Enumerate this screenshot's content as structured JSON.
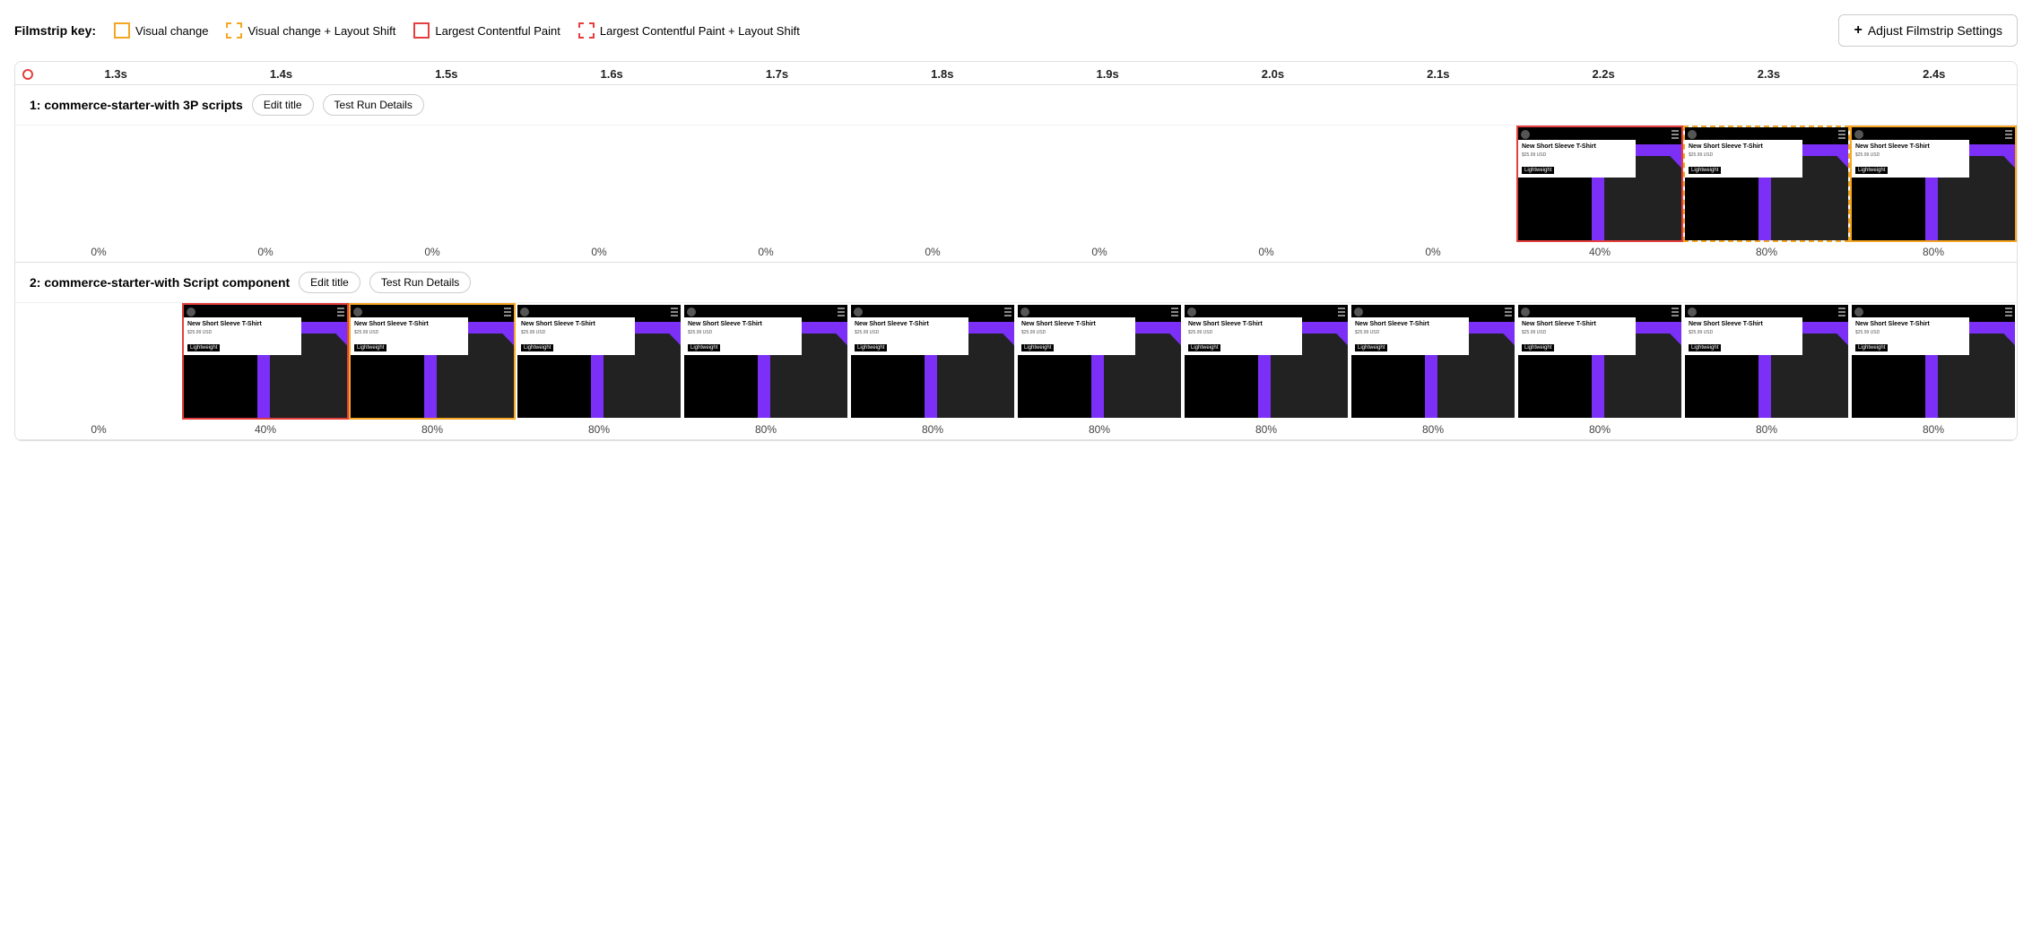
{
  "legend": {
    "key_label": "Filmstrip key:",
    "items": [
      {
        "id": "visual-change",
        "label": "Visual change",
        "border_style": "solid-yellow"
      },
      {
        "id": "visual-change-layout-shift",
        "label": "Visual change + Layout Shift",
        "border_style": "dashed-yellow"
      },
      {
        "id": "lcp",
        "label": "Largest Contentful Paint",
        "border_style": "solid-red"
      },
      {
        "id": "lcp-layout-shift",
        "label": "Largest Contentful Paint + Layout Shift",
        "border_style": "dashed-red"
      }
    ],
    "adjust_button": "Adjust Filmstrip Settings"
  },
  "timeline": {
    "ticks": [
      "1.3s",
      "1.4s",
      "1.5s",
      "1.6s",
      "1.7s",
      "1.8s",
      "1.9s",
      "2.0s",
      "2.1s",
      "2.2s",
      "2.3s",
      "2.4s"
    ]
  },
  "tests": [
    {
      "id": "test1",
      "title": "1: commerce-starter-with 3P scripts",
      "edit_label": "Edit title",
      "details_label": "Test Run Details",
      "frames": [
        {
          "border": "none",
          "empty": true,
          "percent": "0%"
        },
        {
          "border": "none",
          "empty": true,
          "percent": "0%"
        },
        {
          "border": "none",
          "empty": true,
          "percent": "0%"
        },
        {
          "border": "none",
          "empty": true,
          "percent": "0%"
        },
        {
          "border": "none",
          "empty": true,
          "percent": "0%"
        },
        {
          "border": "none",
          "empty": true,
          "percent": "0%"
        },
        {
          "border": "none",
          "empty": true,
          "percent": "0%"
        },
        {
          "border": "none",
          "empty": true,
          "percent": "0%"
        },
        {
          "border": "none",
          "empty": true,
          "percent": "0%"
        },
        {
          "border": "solid-red",
          "empty": false,
          "percent": "40%"
        },
        {
          "border": "dashed-yellow",
          "empty": false,
          "percent": "80%"
        },
        {
          "border": "solid-yellow",
          "empty": false,
          "percent": "80%"
        }
      ]
    },
    {
      "id": "test2",
      "title": "2: commerce-starter-with Script component",
      "edit_label": "Edit title",
      "details_label": "Test Run Details",
      "frames": [
        {
          "border": "none",
          "empty": true,
          "percent": "0%"
        },
        {
          "border": "solid-red",
          "empty": false,
          "percent": "40%"
        },
        {
          "border": "solid-yellow",
          "empty": false,
          "percent": "80%"
        },
        {
          "border": "none",
          "empty": false,
          "percent": "80%"
        },
        {
          "border": "none",
          "empty": false,
          "percent": "80%"
        },
        {
          "border": "none",
          "empty": false,
          "percent": "80%"
        },
        {
          "border": "none",
          "empty": false,
          "percent": "80%"
        },
        {
          "border": "none",
          "empty": false,
          "percent": "80%"
        },
        {
          "border": "none",
          "empty": false,
          "percent": "80%"
        },
        {
          "border": "none",
          "empty": false,
          "percent": "80%"
        },
        {
          "border": "none",
          "empty": false,
          "percent": "80%"
        },
        {
          "border": "none",
          "empty": false,
          "percent": "80%"
        }
      ]
    }
  ],
  "product": {
    "title": "New Short Sleeve T-Shirt",
    "price": "$25.99 USD",
    "badge": "Lightweight"
  }
}
